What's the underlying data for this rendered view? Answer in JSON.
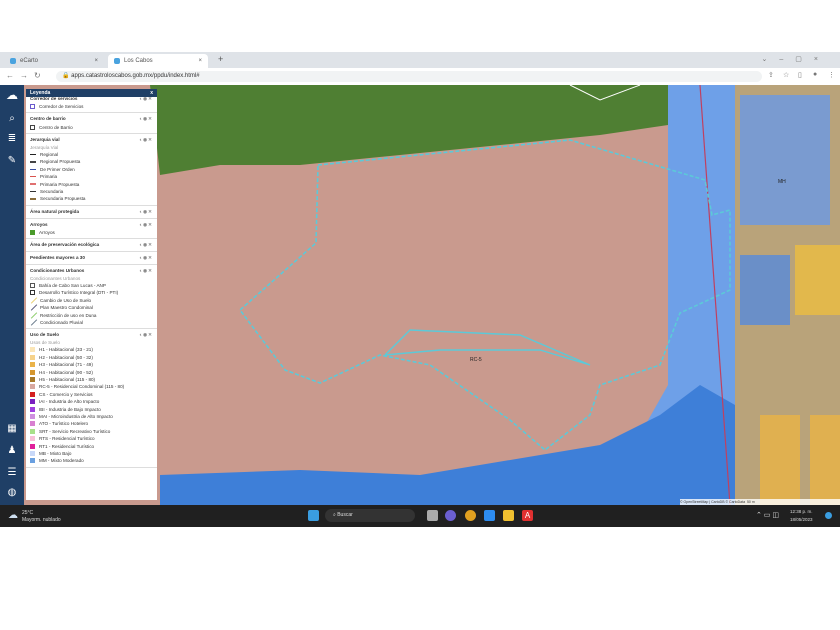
{
  "browser": {
    "tabs": [
      {
        "label": "eCarto"
      },
      {
        "label": "Los Cabos"
      }
    ],
    "url": "apps.catastroloscabos.gob.mx/ppdu/index.html#"
  },
  "legend": {
    "title": "Leyenda",
    "close": "x",
    "groups": [
      {
        "title": "Corredor de servicios",
        "items": [
          {
            "label": "Corredor de Servicios",
            "type": "box",
            "color": "#6a5acd"
          }
        ]
      },
      {
        "title": "Centro de barrio",
        "items": [
          {
            "label": "Centro de Barrio",
            "type": "box",
            "color": "#444444"
          }
        ]
      },
      {
        "title": "Jerarquia vial",
        "subtitle": "Jerarquía Vial",
        "items": [
          {
            "label": "Regional",
            "type": "line",
            "color": "#222222"
          },
          {
            "label": "Regional Propuesta",
            "type": "line",
            "color": "#444444"
          },
          {
            "label": "De Primer Orden",
            "type": "line",
            "color": "#3a4fa0"
          },
          {
            "label": "Primaria",
            "type": "line",
            "color": "#d9534f"
          },
          {
            "label": "Primaria Propuesta",
            "type": "line",
            "color": "#e07070"
          },
          {
            "label": "Secundaria",
            "type": "line",
            "color": "#333333"
          },
          {
            "label": "Secundaria Propuesta",
            "type": "line",
            "color": "#8a6d3b"
          }
        ]
      },
      {
        "title": "Área natural protegida",
        "items": []
      },
      {
        "title": "Arroyos",
        "items": [
          {
            "label": "Arroyos",
            "type": "fill",
            "color": "#4a9a2a"
          }
        ]
      },
      {
        "title": "Área de preservación ecológica",
        "items": []
      },
      {
        "title": "Pendientes mayores a 30",
        "items": []
      },
      {
        "title": "Condicionantes Urbanos",
        "subtitle": "Condicionantes Urbanos",
        "items": [
          {
            "label": "Bahía de Cabo San Lucas - ANP",
            "type": "box",
            "color": "#555555"
          },
          {
            "label": "Desarrollo Turístico Integral (DTI - PTI)",
            "type": "box",
            "color": "#333333"
          },
          {
            "label": "Cambio de Uso de Suelo",
            "type": "diag",
            "color": "#e8d070"
          },
          {
            "label": "Plan Maestro Condominal",
            "type": "diag",
            "color": "#555577"
          },
          {
            "label": "Restricción de uso en Duna",
            "type": "diag",
            "color": "#88cc66"
          },
          {
            "label": "Condicionado Pluvial",
            "type": "diag",
            "color": "#667788"
          }
        ]
      },
      {
        "title": "Uso de Suelo",
        "subtitle": "Usos de Suelo",
        "items": [
          {
            "label": "H1 - Habitacional (33 - 21)",
            "type": "fill",
            "color": "#fbe6b8"
          },
          {
            "label": "H2 - Habitacional (50 - 32)",
            "type": "fill",
            "color": "#f6d28a"
          },
          {
            "label": "H3 - Habitacional (71 - 49)",
            "type": "fill",
            "color": "#eab34a"
          },
          {
            "label": "H4 - Habitacional (90 - 52)",
            "type": "fill",
            "color": "#d5962e"
          },
          {
            "label": "H5 - Habitacional (115 - 80)",
            "type": "fill",
            "color": "#a87a2a"
          },
          {
            "label": "RC-5 - Residencial Condominal (115 - 80)",
            "type": "fill",
            "color": "#d8a8a0"
          },
          {
            "label": "CS - Comercio y Servicios",
            "type": "fill",
            "color": "#d42020"
          },
          {
            "label": "IAI - Industria de Alto Impacto",
            "type": "fill",
            "color": "#7a1fc0"
          },
          {
            "label": "IBI - Industria de Bajo Impacto",
            "type": "fill",
            "color": "#a040e0"
          },
          {
            "label": "MAI - Microindustria de Alto Impacto",
            "type": "fill",
            "color": "#d090e0"
          },
          {
            "label": "ATO - Turístico Hotelero",
            "type": "fill",
            "color": "#d880d0"
          },
          {
            "label": "SRT - Servicio Recreativo Turístico",
            "type": "fill",
            "color": "#a8e08a"
          },
          {
            "label": "RTS - Residencial Turístico",
            "type": "fill",
            "color": "#f8c0d8"
          },
          {
            "label": "RT1 - Residencial Turístico",
            "type": "fill",
            "color": "#e0209a"
          },
          {
            "label": "MB - Mixto Bajo",
            "type": "fill",
            "color": "#c8d8f8"
          },
          {
            "label": "MM - Mixto Moderado",
            "type": "fill",
            "color": "#6aa0e0"
          }
        ]
      }
    ]
  },
  "map": {
    "labels": [
      {
        "text": "RC-5"
      },
      {
        "text": "MH"
      }
    ],
    "attribution": "© OpenStreetMap | CartoDB © CartoData",
    "scale": "50 m",
    "zoom_in": "+",
    "zoom_out": "−",
    "colors": {
      "green": "#4f7f33",
      "pink": "#c99a8e",
      "blue": "#3e7fd8",
      "boundary": "#5cc9d8"
    }
  },
  "taskbar": {
    "weather_temp": "25°C",
    "weather_desc": "Mayorm. nublado",
    "search": "Buscar",
    "time": "12:38 p. m.",
    "date": "18/05/2023"
  }
}
